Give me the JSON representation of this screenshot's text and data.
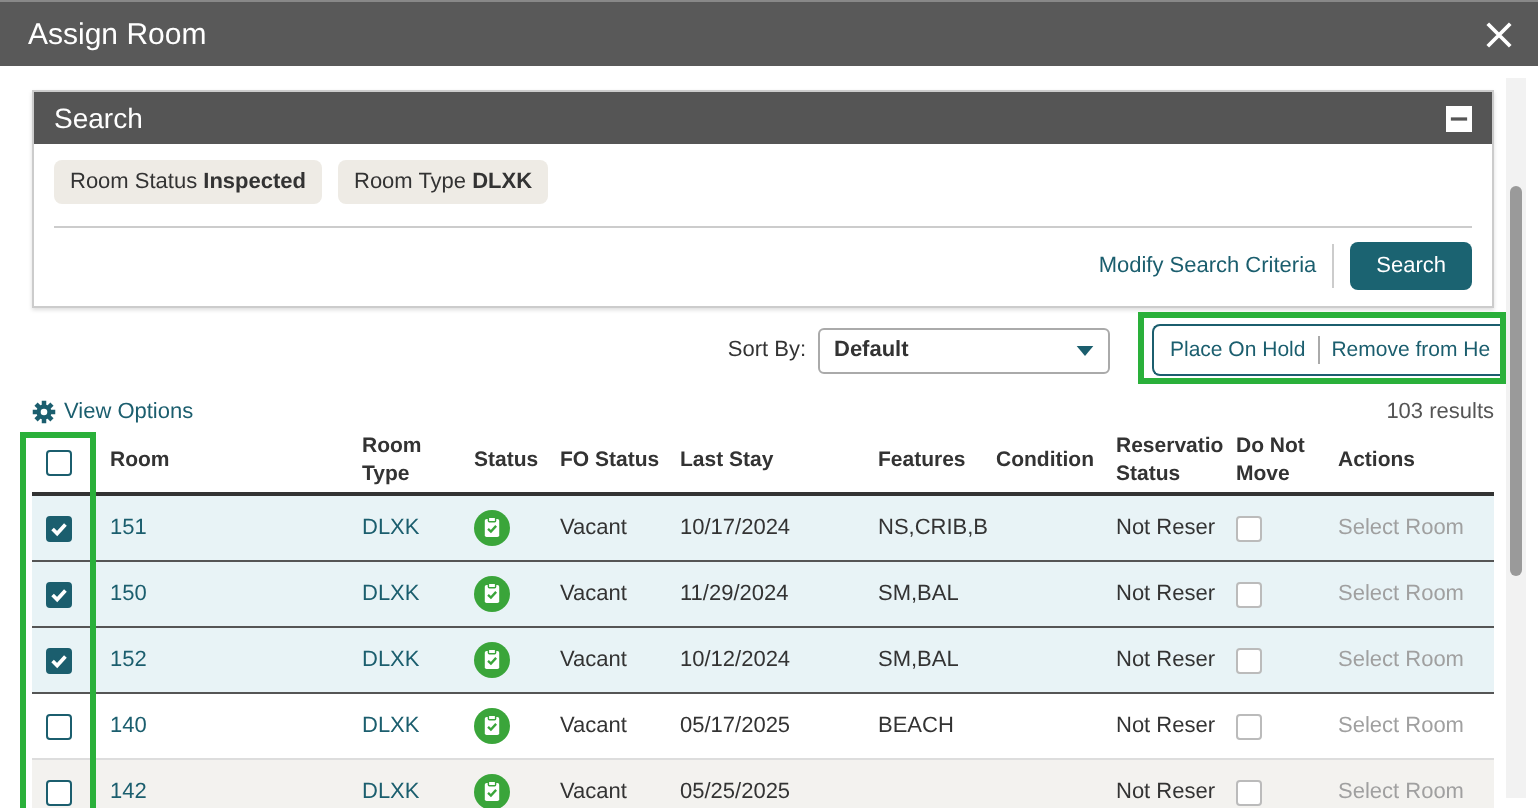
{
  "window": {
    "title": "Assign Room"
  },
  "search": {
    "title": "Search",
    "chips": [
      {
        "label": "Room Status",
        "value": "Inspected"
      },
      {
        "label": "Room Type",
        "value": "DLXK"
      }
    ],
    "modify_link": "Modify Search Criteria",
    "search_button": "Search"
  },
  "sort": {
    "label": "Sort By:",
    "value": "Default"
  },
  "hold_actions": [
    "Place On Hold",
    "Remove from He"
  ],
  "view_options": "View Options",
  "results": "103 results",
  "table": {
    "select_all": {
      "checked": false
    },
    "columns": [
      "Room",
      "Room Type",
      "Status",
      "FO Status",
      "Last Stay",
      "Features",
      "Condition",
      "Reservatio Status",
      "Do Not Move",
      "Actions"
    ],
    "rows": [
      {
        "checked": true,
        "hover": false,
        "room": "151",
        "room_type": "DLXK",
        "fo_status": "Vacant",
        "last_stay": "10/17/2024",
        "features": "NS,CRIB,B",
        "reservation_status": "Not Reser",
        "do_not_move": false,
        "action": "Select Room",
        "action_disabled": true
      },
      {
        "checked": true,
        "hover": false,
        "room": "150",
        "room_type": "DLXK",
        "fo_status": "Vacant",
        "last_stay": "11/29/2024",
        "features": "SM,BAL",
        "reservation_status": "Not Reser",
        "do_not_move": false,
        "action": "Select Room",
        "action_disabled": true
      },
      {
        "checked": true,
        "hover": false,
        "room": "152",
        "room_type": "DLXK",
        "fo_status": "Vacant",
        "last_stay": "10/12/2024",
        "features": "SM,BAL",
        "reservation_status": "Not Reser",
        "do_not_move": false,
        "action": "Select Room",
        "action_disabled": true
      },
      {
        "checked": false,
        "hover": false,
        "room": "140",
        "room_type": "DLXK",
        "fo_status": "Vacant",
        "last_stay": "05/17/2025",
        "features": "BEACH",
        "reservation_status": "Not Reser",
        "do_not_move": false,
        "action": "Select Room",
        "action_disabled": true
      },
      {
        "checked": false,
        "hover": true,
        "room": "142",
        "room_type": "DLXK",
        "fo_status": "Vacant",
        "last_stay": "05/25/2025",
        "features": "",
        "reservation_status": "Not Reser",
        "do_not_move": false,
        "action": "Select Room",
        "action_disabled": true
      }
    ]
  }
}
